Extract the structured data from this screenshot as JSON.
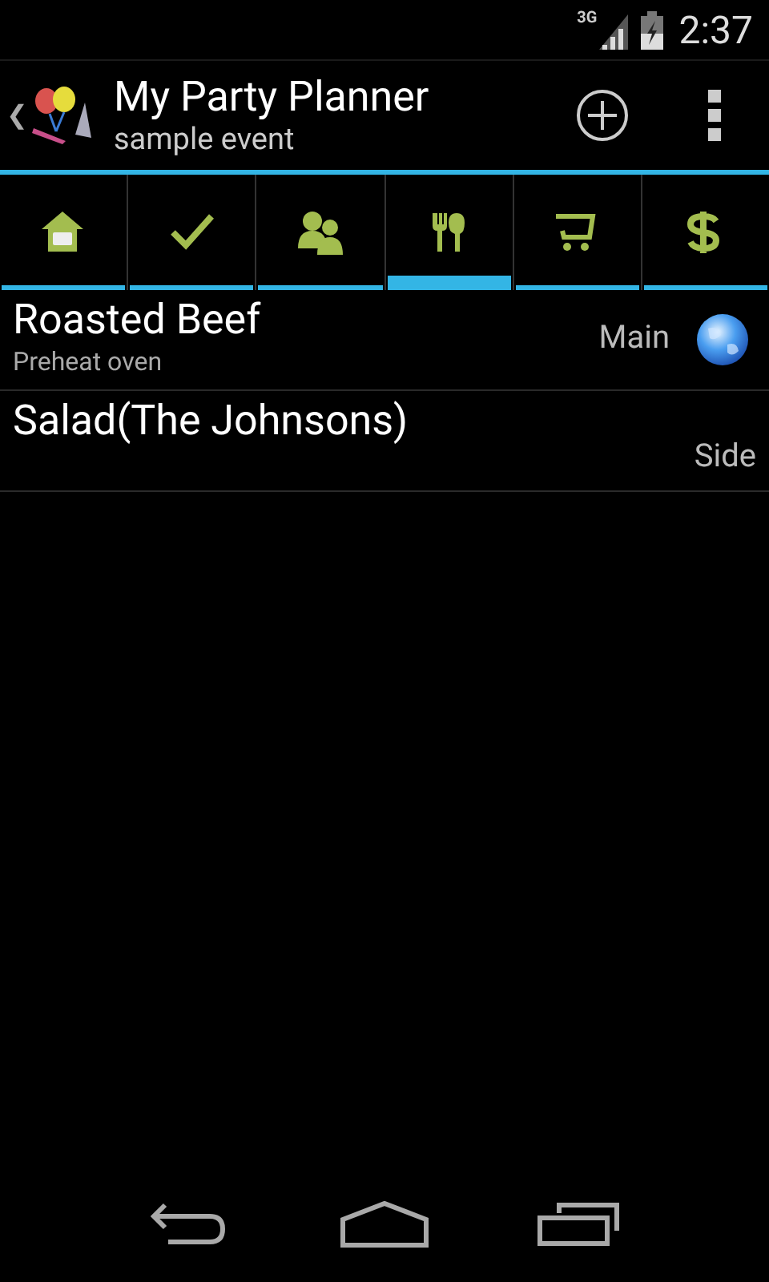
{
  "status_bar": {
    "network": "3G",
    "time": "2:37"
  },
  "action_bar": {
    "back": "❮",
    "title": "My Party Planner",
    "subtitle": "sample event"
  },
  "tabs": [
    {
      "kind": "home",
      "selected": false
    },
    {
      "kind": "tasks",
      "selected": false
    },
    {
      "kind": "guests",
      "selected": false
    },
    {
      "kind": "menu",
      "selected": true
    },
    {
      "kind": "shopping",
      "selected": false
    },
    {
      "kind": "budget",
      "selected": false
    }
  ],
  "items": [
    {
      "title": "Roasted Beef",
      "subtitle": "Preheat oven",
      "category": "Main",
      "online": true
    },
    {
      "title": "Salad(The Johnsons)",
      "category": "Side",
      "online": false
    }
  ]
}
